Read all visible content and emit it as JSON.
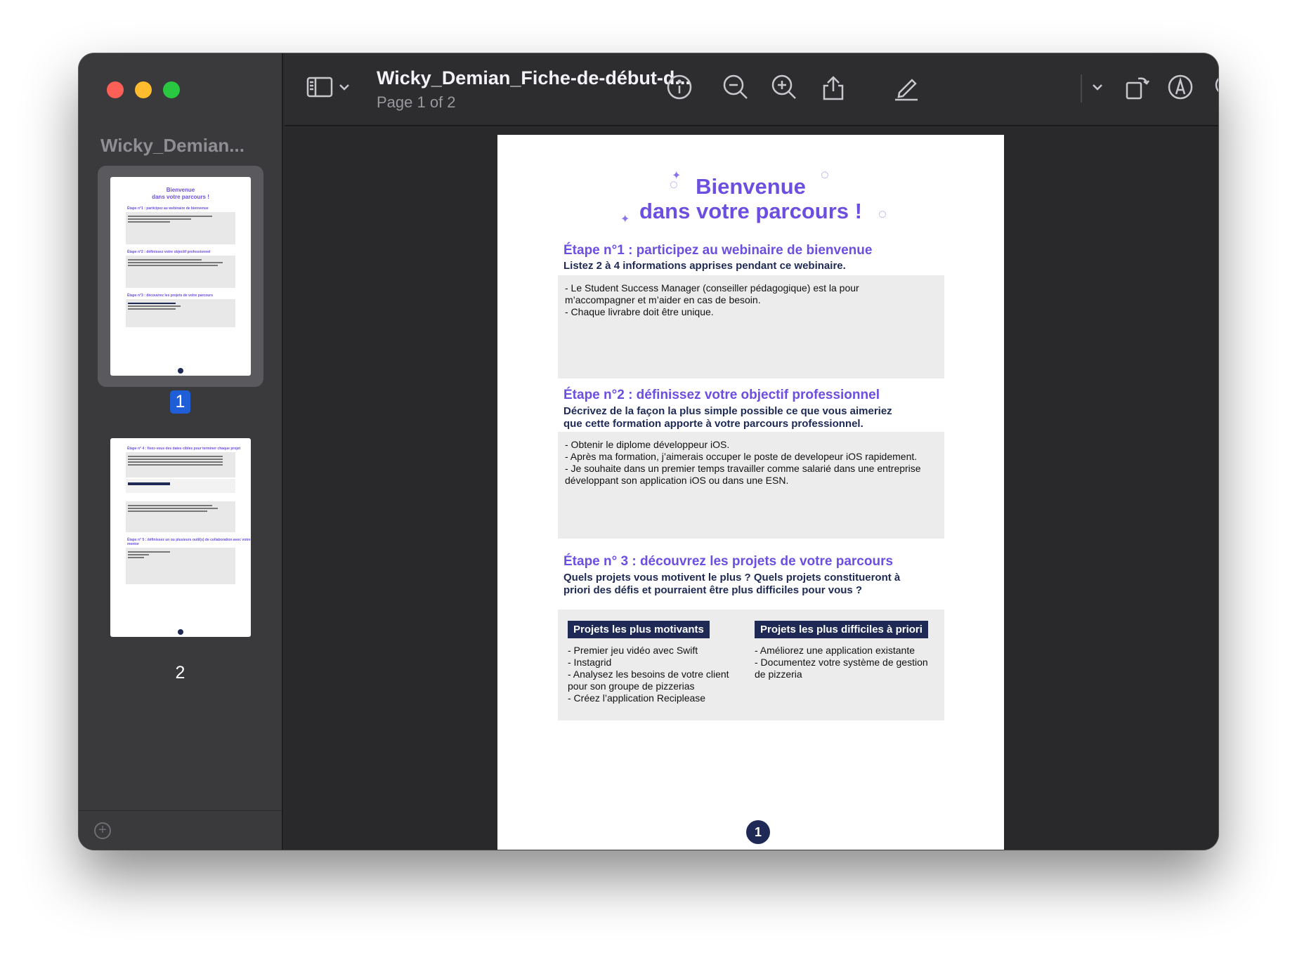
{
  "window": {
    "title": "Wicky_Demian_Fiche-de-début-d...",
    "subtitle": "Page 1 of 2"
  },
  "sidebar": {
    "title": "Wicky_Demian...",
    "thumbnails": [
      {
        "label": "1",
        "selected": true
      },
      {
        "label": "2",
        "selected": false
      }
    ]
  },
  "toolbar": {
    "icons": [
      "sidebar-toggle-icon",
      "chevron-down-icon",
      "info-icon",
      "zoom-out-icon",
      "zoom-in-icon",
      "share-icon",
      "markup-pen-icon",
      "chevron-down-icon",
      "rotate-icon",
      "annotate-icon",
      "search-icon"
    ]
  },
  "document": {
    "title_line1": "Bienvenue",
    "title_line2": "dans votre parcours !",
    "step1": {
      "heading": "Étape n°1 : participez au webinaire de bienvenue",
      "sub": "Listez 2 à 4 informations apprises pendant ce webinaire.",
      "answer": "- Le Student Success Manager (conseiller pédagogique) est la pour\nm’accompagner et m’aider en cas de besoin.\n- Chaque livrabre doit être unique."
    },
    "step2": {
      "heading": "Étape n°2 : définissez votre objectif professionnel",
      "sub": "Décrivez de la façon la plus simple possible ce que vous aimeriez\nque cette formation apporte à votre parcours professionnel.",
      "answer": "- Obtenir le diplome développeur iOS.\n- Après ma formation, j’aimerais occuper le poste de developeur iOS rapidement.\n- Je souhaite dans un premier temps travailler comme salarié dans une entreprise\ndéveloppant son application iOS ou dans une ESN."
    },
    "step3": {
      "heading": "Étape n° 3 : découvrez les projets de votre parcours",
      "sub": "Quels projets vous motivent le plus ? Quels projets constitueront à\npriori des défis et pourraient être plus difficiles pour vous ?",
      "col1_head": "Projets les plus motivants",
      "col1_text": "- Premier jeu vidéo avec Swift\n- Instagrid\n- Analysez les besoins de votre client\npour son groupe de pizzerias\n- Créez l’application Reciplease",
      "col2_head": "Projets les plus difficiles à priori",
      "col2_text": "- Améliorez une application existante\n- Documentez votre système de gestion\nde pizzeria"
    },
    "page_number": "1"
  },
  "thumb1": {
    "title": "Bienvenue\ndans votre parcours !",
    "h1": "Étape n°1 : participez au webinaire de bienvenue",
    "h2": "Étape n°2 : définissez votre objectif professionnel",
    "h3": "Étape n°3 : découvrez les projets de votre parcours"
  },
  "thumb2": {
    "h1": "Étape n° 4 : fixez-vous des dates cibles pour terminer chaque projet",
    "h2": "Étape n° 5 : définissez un ou plusieurs outil(s) de collaboration avec votre mentor"
  }
}
